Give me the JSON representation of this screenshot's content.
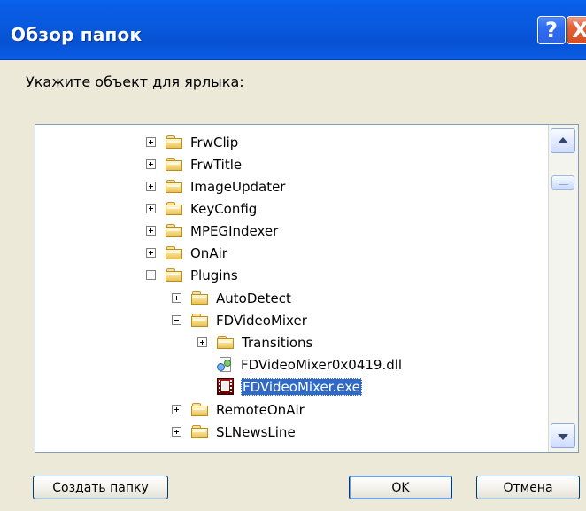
{
  "window": {
    "title": "Обзор папок",
    "help_label": "?",
    "close_label": "X"
  },
  "dialog": {
    "prompt": "Укажите объект для ярлыка:"
  },
  "tree": {
    "items": [
      {
        "label": "FrwClip",
        "type": "folder",
        "expander": "plus"
      },
      {
        "label": "FrwTitle",
        "type": "folder",
        "expander": "plus"
      },
      {
        "label": "ImageUpdater",
        "type": "folder",
        "expander": "plus"
      },
      {
        "label": "KeyConfig",
        "type": "folder",
        "expander": "plus"
      },
      {
        "label": "MPEGIndexer",
        "type": "folder",
        "expander": "plus"
      },
      {
        "label": "OnAir",
        "type": "folder",
        "expander": "plus"
      },
      {
        "label": "Plugins",
        "type": "folder",
        "expander": "minus"
      },
      {
        "label": "AutoDetect",
        "type": "folder",
        "expander": "plus"
      },
      {
        "label": "FDVideoMixer",
        "type": "folder",
        "expander": "minus"
      },
      {
        "label": "Transitions",
        "type": "folder",
        "expander": "plus"
      },
      {
        "label": "FDVideoMixer0x0419.dll",
        "type": "dll"
      },
      {
        "label": "FDVideoMixer.exe",
        "type": "exe",
        "selected": true
      },
      {
        "label": "RemoteOnAir",
        "type": "folder",
        "expander": "plus"
      },
      {
        "label": "SLNewsLine",
        "type": "folder",
        "expander": "plus"
      }
    ]
  },
  "buttons": {
    "create_folder": "Создать папку",
    "ok": "OK",
    "cancel": "Отмена"
  },
  "icons": {
    "help": "help-icon",
    "close": "close-icon",
    "folder": "folder-icon",
    "dll": "dll-file-icon",
    "exe": "exe-file-icon",
    "scroll_up": "chevron-up-icon",
    "scroll_down": "chevron-down-icon"
  },
  "colors": {
    "titlebar": "#0a5de6",
    "selection": "#316ac5",
    "dialog_background": "#ece9d8"
  }
}
